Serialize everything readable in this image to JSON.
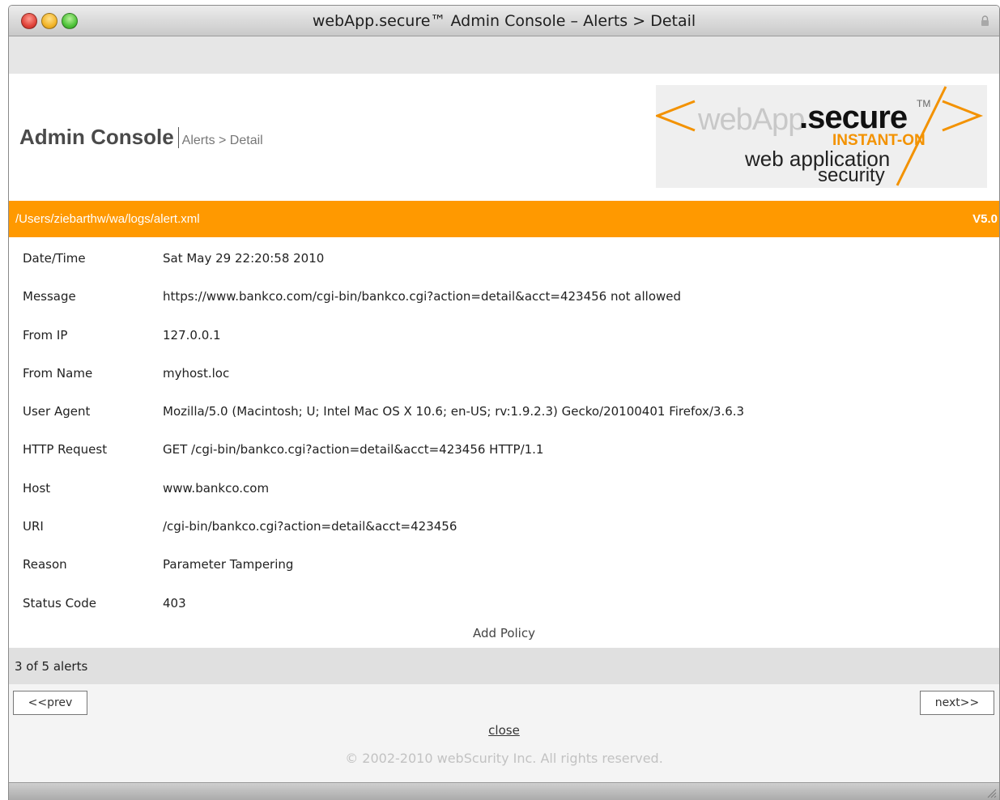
{
  "window": {
    "title": "webApp.secure™ Admin Console – Alerts > Detail",
    "lock_icon": "lock-icon"
  },
  "header": {
    "brand": "Admin Console",
    "breadcrumb": "Alerts > Detail"
  },
  "logo": {
    "web": "webApp",
    "secure": ".secure",
    "tm": "TM",
    "instant": "INSTANT-ON",
    "line1": "web application",
    "line2": "security",
    "accent_color": "#f39200"
  },
  "file_bar": {
    "path": "/Users/ziebarthw/wa/logs/alert.xml",
    "version": "V5.0",
    "color": "#ff9900"
  },
  "details": [
    {
      "label": "Date/Time",
      "value": "Sat May 29 22:20:58 2010"
    },
    {
      "label": "Message",
      "value": "https://www.bankco.com/cgi-bin/bankco.cgi?action=detail&acct=423456 not allowed"
    },
    {
      "label": "From IP",
      "value": "127.0.0.1"
    },
    {
      "label": "From Name",
      "value": "myhost.loc"
    },
    {
      "label": "User Agent",
      "value": "Mozilla/5.0 (Macintosh; U; Intel Mac OS X 10.6; en-US; rv:1.9.2.3) Gecko/20100401 Firefox/3.6.3"
    },
    {
      "label": "HTTP Request",
      "value": "GET /cgi-bin/bankco.cgi?action=detail&acct=423456 HTTP/1.1"
    },
    {
      "label": "Host",
      "value": "www.bankco.com"
    },
    {
      "label": "URI",
      "value": "/cgi-bin/bankco.cgi?action=detail&acct=423456"
    },
    {
      "label": "Reason",
      "value": "Parameter Tampering"
    },
    {
      "label": "Status Code",
      "value": "403"
    }
  ],
  "actions": {
    "add_policy": "Add Policy"
  },
  "pagination": {
    "count_text": "3 of 5 alerts",
    "prev_label": "<<prev",
    "next_label": "next>>"
  },
  "footer": {
    "close_label": "close",
    "copyright": "© 2002-2010 webScurity Inc. All rights reserved."
  }
}
